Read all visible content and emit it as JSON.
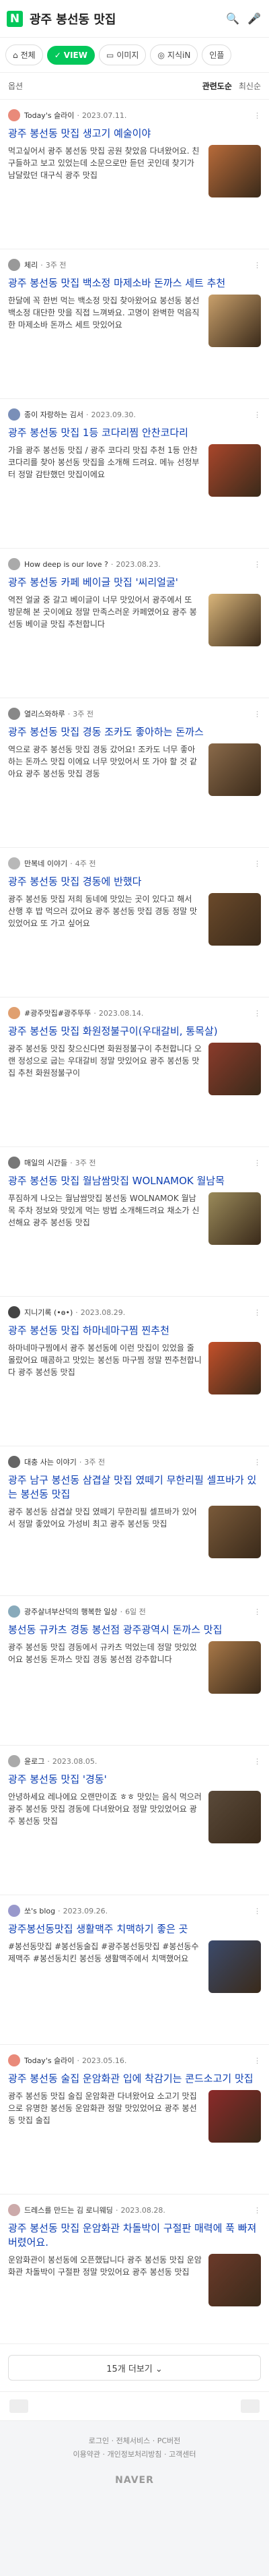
{
  "header": {
    "logo": "N",
    "query": "광주 봉선동 맛집"
  },
  "tabs": [
    {
      "label": "전체"
    },
    {
      "label": "VIEW"
    },
    {
      "label": "이미지"
    },
    {
      "label": "지식iN"
    },
    {
      "label": "인플"
    }
  ],
  "options": {
    "label": "옵션",
    "sort_related": "관련도순",
    "sort_latest": "최신순"
  },
  "posts": [
    {
      "author": "Today's 슬라이",
      "date": "2023.07.11.",
      "title": "광주 봉선동 맛집 생고기 예술이야",
      "desc": "먹고싶어서 광주 봉선동 맛집 공원 찾았음 다녀왔어요. 친구들하고 보고 있었는데 소문으로만 듣던 곳인데 찾기가 남달랐던 대구식 광주 맛집",
      "count": "",
      "color": "#b86b3a",
      "avatar": "#e98a7a"
    },
    {
      "author": "체리",
      "date": "3주 전",
      "title": "광주 봉선동 맛집 백소정 마제소바 돈까스 세트 추천",
      "desc": "한달에 꼭 한번 먹는 백소정 맛집 찾아왔어요 봉선동 봉선 백소정 대단한 맛을 직접 느껴봐요. 고명이 완벽한 먹음직한 마제소바 돈까스 세트 맛있어요",
      "count": "",
      "color": "#c9a06b",
      "avatar": "#999"
    },
    {
      "author": "종이 자랑하는 김서",
      "date": "2023.09.30.",
      "title": "광주 봉선동 맛집 1등 코다리찜 안찬코다리",
      "desc": "가을 광주 봉선동 맛집 / 광주 코다리 맛집 추천 1등 안찬코다리를 찾아 봉선동 맛집을 소개해 드려요. 메뉴 선정부터 정말 감탄했던 맛집이에요",
      "count": "",
      "color": "#a9462b",
      "avatar": "#7a8fb8"
    },
    {
      "author": "How deep is our love ?",
      "date": "2023.08.23.",
      "title": "광주 봉선동 카페 베이글 맛집 '씨리얼굴'",
      "desc": "역전 얼굴 중 갈고 베이글이 너무 맛있어서 광주에서 또 방문해 본 곳이에요 정말 만족스러운 카페였어요 광주 봉선동 베이글 맛집 추천합니다",
      "count": "",
      "color": "#d9b57a",
      "avatar": "#aaa"
    },
    {
      "author": "열리스와하루",
      "date": "3주 전",
      "title": "광주 봉선동 맛집 경동 조카도 좋아하는 돈까스",
      "desc": "역으로 광주 봉선동 맛집 경동 갔어요! 조카도 너무 좋아하는 돈까스 맛집 이에요 너무 맛있어서 또 가야 할 것 같아요 광주 봉선동 맛집 경동",
      "count": "",
      "color": "#8a6a4a",
      "avatar": "#888"
    },
    {
      "author": "만복네 이야기",
      "date": "4주 전",
      "title": "광주 봉선동 맛집 경동에 반했다",
      "desc": "광주 봉선동 맛집 저희 동네에 맛있는 곳이 있다고 해서 산행 후 밥 먹으러 갔어요 광주 봉선동 맛집 경동 정말 맛있었어요 또 가고 싶어요",
      "count": "",
      "color": "#6b4a2b",
      "avatar": "#b8b8b8"
    },
    {
      "author": "#광주맛집#광주뚜뚜",
      "date": "2023.08.14.",
      "title": "광주 봉선동 맛집 화원정불구이(우대갈비, 통목살)",
      "desc": "광주 봉선동 맛집 찾으신다면 화원정불구이 추천합니다 오랜 정성으로 굽는 우대갈비 정말 맛있어요 광주 봉선동 맛집 추천 화원정불구이",
      "count": "",
      "color": "#8b3b2b",
      "avatar": "#e0a070"
    },
    {
      "author": "매일의 시간들",
      "date": "3주 전",
      "title": "광주 봉선동 맛집 월남쌈맛집 WOLNAMOK 월남목",
      "desc": "푸짐하게 나오는 월남쌈맛집 봉선동 WOLNAMOK 월남목 주차 정보와 맛있게 먹는 방법 소개해드려요 채소가 신선해요 광주 봉선동 맛집",
      "count": "",
      "color": "#9a8a5a",
      "avatar": "#777"
    },
    {
      "author": "지니기록 (•ө•)",
      "date": "2023.08.29.",
      "title": "광주 봉선동 맛집 하마네마구찜 찐추천",
      "desc": "하마네마구찜에서 광주 봉선동에 이런 맛집이 있었을 줄 몰랐어요 매콤하고 맛있는 봉선동 마구찜 정말 찐추천합니다 광주 봉선동 맛집",
      "count": "",
      "color": "#c4502a",
      "avatar": "#444"
    },
    {
      "author": "대충 사는 이야기",
      "date": "3주 전",
      "title": "광주 남구 봉선동 삼겹살 맛집 였떼기 무한리필 셀프바가 있는 봉선동 맛집",
      "desc": "광주 봉선동 삼겹살 맛집 였떼기 무한리필 셀프바가 있어서 정말 좋았어요 가성비 최고 광주 봉선동 맛집",
      "count": "",
      "color": "#7a5a3a",
      "avatar": "#666"
    },
    {
      "author": "광주살녀부산덕의 행복한 일상",
      "date": "6일 전",
      "title": "봉선동 규카츠 경동 봉선점 광주광역시 돈까스 맛집",
      "desc": "광주 봉선동 맛집 경동에서 규카츠 먹었는데 정말 맛있었어요 봉선동 돈까스 맛집 경동 봉선점 강추합니다",
      "count": "",
      "color": "#a87848",
      "avatar": "#8ab"
    },
    {
      "author": "윤로그",
      "date": "2023.08.05.",
      "title": "광주 봉선동 맛집 '경동'",
      "desc": "안녕하세요 레나에요 오랜만이죠 ㅎㅎ 맛있는 음식 먹으러 광주 봉선동 맛집 경동에 다녀왔어요 정말 맛있었어요 광주 봉선동 맛집",
      "count": "",
      "color": "#5a4a3a",
      "avatar": "#aaa"
    },
    {
      "author": "쏘's blog",
      "date": "2023.09.26.",
      "title": "광주봉선동맛집 생활맥주 치맥하기 좋은 곳",
      "desc": "#봉선동맛집 #봉선동술집 #광주봉선동맛집 #봉선동수제맥주 #봉선동치킨 봉선동 생활맥주에서 치맥했어요",
      "count": "",
      "color": "#3b4a6b",
      "avatar": "#99c"
    },
    {
      "author": "Today's 슬라이",
      "date": "2023.05.16.",
      "title": "광주 봉선동 술집 운암화관 입에 착감기는 콘드소고기 맛집",
      "desc": "광주 봉선동 맛집 술집 운암화관 다녀왔어요 소고기 맛집으로 유명한 봉선동 운암화관 정말 맛있었어요 광주 봉선동 맛집 술집",
      "count": "",
      "color": "#8b2a2a",
      "avatar": "#e98a7a"
    },
    {
      "author": "드레스를 만드는 김 로니웨딩",
      "date": "2023.08.28.",
      "title": "광주 봉선동 맛집 운암화관 차돌박이 구절판 매력에 푹 빠져버렸어요.",
      "desc": "운암화관이 봉선동에 오픈했답니다 광주 봉선동 맛집 운암화관 차돌박이 구절판 정말 맛있어요 광주 봉선동 맛집",
      "count": "",
      "color": "#6b3a2a",
      "avatar": "#caa"
    }
  ],
  "more_button": "15개 더보기 ⌄",
  "footer": {
    "line1": "로그인 · 전체서비스 · PC버전",
    "line2": "이용약관 · 개인정보처리방침 · 고객센터",
    "brand": "NAVER"
  },
  "colors": {
    "accent": "#03c75a",
    "link": "#0d3fb3"
  }
}
